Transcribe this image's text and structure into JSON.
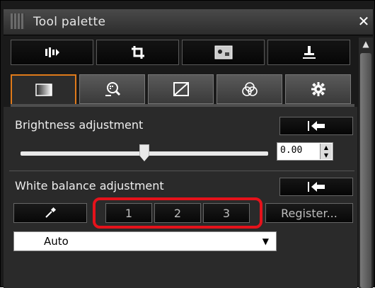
{
  "window": {
    "title": "Tool palette"
  },
  "toolbar": {
    "items": [
      {
        "name": "histogram-tool",
        "icon": "levels-icon"
      },
      {
        "name": "crop-tool",
        "icon": "crop-icon"
      },
      {
        "name": "image-tool",
        "icon": "image-icon"
      },
      {
        "name": "stamp-tool",
        "icon": "stamp-icon"
      }
    ]
  },
  "tabs": [
    {
      "name": "basic",
      "icon": "gradient-square-icon",
      "active": true
    },
    {
      "name": "detail",
      "icon": "magnifier-icon",
      "active": false
    },
    {
      "name": "curve",
      "icon": "curve-icon",
      "active": false
    },
    {
      "name": "color",
      "icon": "color-circles-icon",
      "active": false
    },
    {
      "name": "settings",
      "icon": "gear-icon",
      "active": false
    }
  ],
  "brightness": {
    "label": "Brightness adjustment",
    "value": "0.00",
    "slider_position": 0.5
  },
  "white_balance": {
    "label": "White balance adjustment",
    "presets": [
      "1",
      "2",
      "3"
    ],
    "register_label": "Register...",
    "selected_option": "Auto"
  },
  "colors": {
    "highlight": "#e5121b",
    "active_tab_border": "#e07a1a"
  }
}
